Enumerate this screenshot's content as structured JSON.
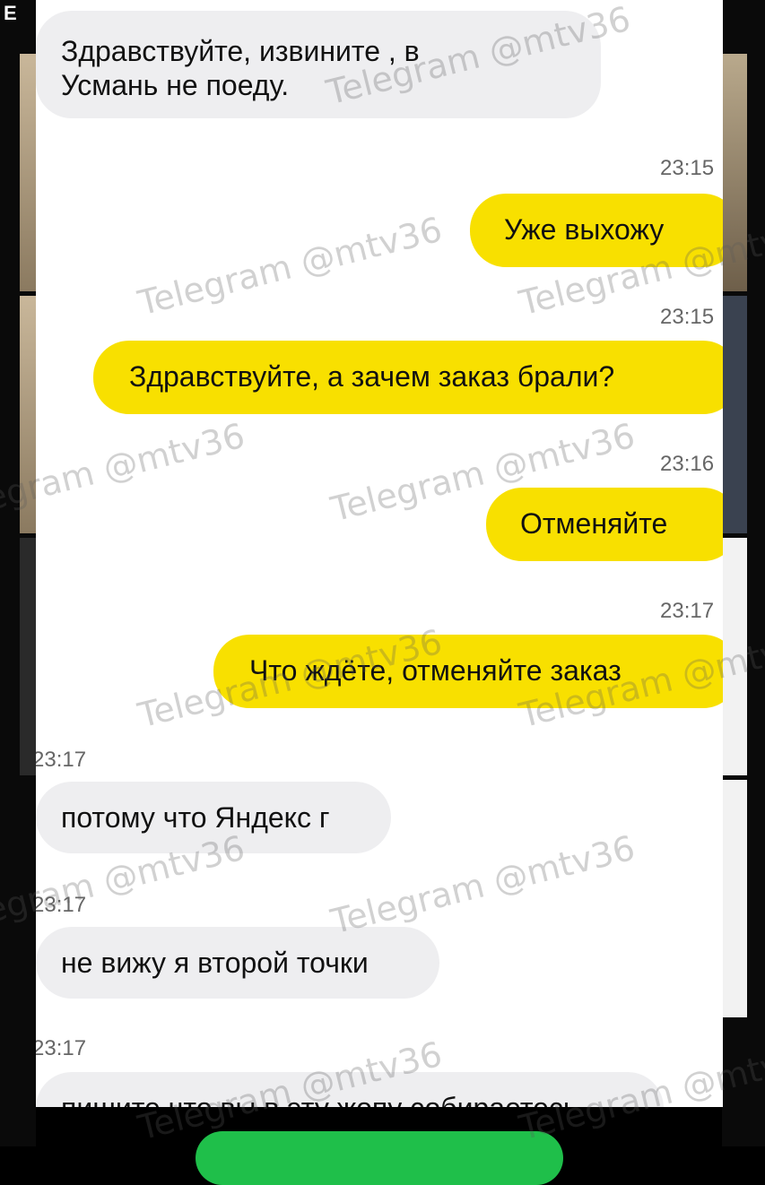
{
  "header": {
    "corner_letter": "E"
  },
  "messages": [
    {
      "dir": "in",
      "text_lines": [
        "Здравствуйте, извините , в",
        "Усмань не поеду."
      ]
    },
    {
      "dir": "out",
      "time": "23:15",
      "text": "Уже выхожу"
    },
    {
      "dir": "out",
      "time": "23:15",
      "text": "Здравствуйте, а зачем заказ брали?"
    },
    {
      "dir": "out",
      "time": "23:16",
      "text": "Отменяйте"
    },
    {
      "dir": "out",
      "time": "23:17",
      "text": "Что ждёте,  отменяйте заказ"
    },
    {
      "dir": "in",
      "time": "23:17",
      "text": "потому что Яндекс г"
    },
    {
      "dir": "in",
      "time": "23:17",
      "text": "не вижу я второй точки"
    },
    {
      "dir": "in",
      "time": "23:17",
      "text": "пишите что вы в эту жопу собираетесь"
    }
  ],
  "watermark": "Telegram @mtv36",
  "colors": {
    "outgoing": "#f8e000",
    "incoming": "#eeeef0",
    "button": "#1fbf4a"
  }
}
